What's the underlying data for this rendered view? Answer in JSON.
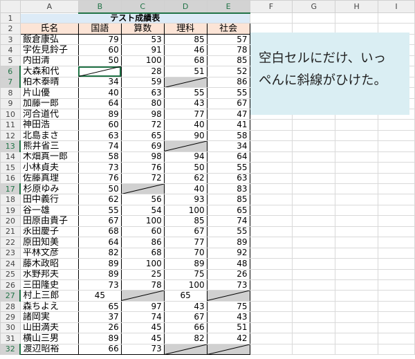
{
  "columns": [
    "A",
    "B",
    "C",
    "D",
    "E",
    "F",
    "G",
    "H",
    "I"
  ],
  "selected_columns": [
    "B",
    "C",
    "D",
    "E"
  ],
  "selected_rows": [
    6,
    7,
    13,
    17,
    27,
    32
  ],
  "title": "テスト成績表",
  "headers": [
    "氏名",
    "国語",
    "算数",
    "理科",
    "社会"
  ],
  "rows": [
    {
      "name": "飯倉康弘",
      "scores": [
        79,
        53,
        85,
        57
      ]
    },
    {
      "name": "宇佐見鈴子",
      "scores": [
        60,
        91,
        46,
        78
      ]
    },
    {
      "name": "内田清",
      "scores": [
        50,
        100,
        68,
        85
      ]
    },
    {
      "name": "大森和代",
      "scores": [
        null,
        28,
        51,
        52
      ]
    },
    {
      "name": "柏木泰晴",
      "scores": [
        34,
        59,
        null,
        86
      ]
    },
    {
      "name": "片山優",
      "scores": [
        40,
        63,
        55,
        55
      ]
    },
    {
      "name": "加藤一郎",
      "scores": [
        64,
        80,
        43,
        67
      ]
    },
    {
      "name": "河合道代",
      "scores": [
        89,
        98,
        77,
        47
      ]
    },
    {
      "name": "神田浩",
      "scores": [
        60,
        72,
        40,
        41
      ]
    },
    {
      "name": "北島まさ",
      "scores": [
        63,
        65,
        90,
        58
      ]
    },
    {
      "name": "熊井省三",
      "scores": [
        74,
        69,
        null,
        34
      ]
    },
    {
      "name": "木畑真一郎",
      "scores": [
        58,
        98,
        94,
        64
      ]
    },
    {
      "name": "小林貞夫",
      "scores": [
        73,
        76,
        50,
        55
      ]
    },
    {
      "name": "佐藤真理",
      "scores": [
        76,
        72,
        62,
        63
      ]
    },
    {
      "name": "杉原ゆみ",
      "scores": [
        50,
        null,
        40,
        83
      ]
    },
    {
      "name": "田中義行",
      "scores": [
        62,
        56,
        93,
        85
      ]
    },
    {
      "name": "谷一雄",
      "scores": [
        55,
        54,
        100,
        65
      ]
    },
    {
      "name": "田原由貴子",
      "scores": [
        67,
        100,
        85,
        74
      ]
    },
    {
      "name": "永田慶子",
      "scores": [
        68,
        60,
        67,
        55
      ]
    },
    {
      "name": "原田知美",
      "scores": [
        64,
        86,
        77,
        89
      ]
    },
    {
      "name": "平林文彦",
      "scores": [
        82,
        68,
        70,
        92
      ]
    },
    {
      "name": "藤木政昭",
      "scores": [
        89,
        100,
        89,
        48
      ]
    },
    {
      "name": "水野邦夫",
      "scores": [
        89,
        25,
        75,
        26
      ]
    },
    {
      "name": "三田隆史",
      "scores": [
        73,
        78,
        100,
        73
      ]
    },
    {
      "name": "村上三郎",
      "scores": [
        45,
        null,
        65,
        null
      ],
      "centered": true
    },
    {
      "name": "森ちよえ",
      "scores": [
        65,
        97,
        43,
        75
      ]
    },
    {
      "name": "諸岡実",
      "scores": [
        37,
        74,
        67,
        43
      ]
    },
    {
      "name": "山田満夫",
      "scores": [
        26,
        45,
        66,
        51
      ]
    },
    {
      "name": "横山三男",
      "scores": [
        89,
        45,
        82,
        42
      ]
    },
    {
      "name": "渡辺昭裕",
      "scores": [
        66,
        73,
        null,
        null
      ]
    }
  ],
  "active_cell": "B6",
  "textbox": {
    "line1": "空白セルにだけ、いっ",
    "line2": "ぺんに斜線がひけた。"
  }
}
